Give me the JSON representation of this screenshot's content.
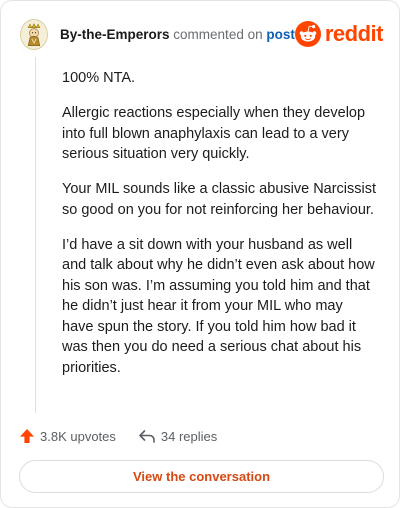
{
  "header": {
    "username": "By-the-Emperors",
    "action_text": "commented on",
    "post_link": "post",
    "brand": "reddit"
  },
  "comment": {
    "paragraphs": [
      "100% NTA.",
      "Allergic reactions especially when they develop into full blown anaphylaxis can lead to a very serious situation very quickly.",
      "Your MIL sounds like a classic abusive Narcissist so good on you for not reinforcing her behaviour.",
      "I’d have a sit down with your husband as well and talk about why he didn’t even ask about how his son was. I’m assuming you told him and that he didn’t just hear it from your MIL who may have spun the story. If you told him how bad it was then you do need a serious chat about his priorities."
    ]
  },
  "actions": {
    "upvotes": "3.8K upvotes",
    "replies": "34 replies"
  },
  "cta": {
    "label": "View the conversation"
  },
  "colors": {
    "brand": "#ff4500",
    "link": "#0f5fb3",
    "cta_text": "#d44a12"
  },
  "icons": {
    "avatar": "emperor-avatar-icon",
    "brand": "reddit-logo-icon",
    "upvote": "upvote-arrow-icon",
    "reply": "reply-arrow-icon"
  }
}
